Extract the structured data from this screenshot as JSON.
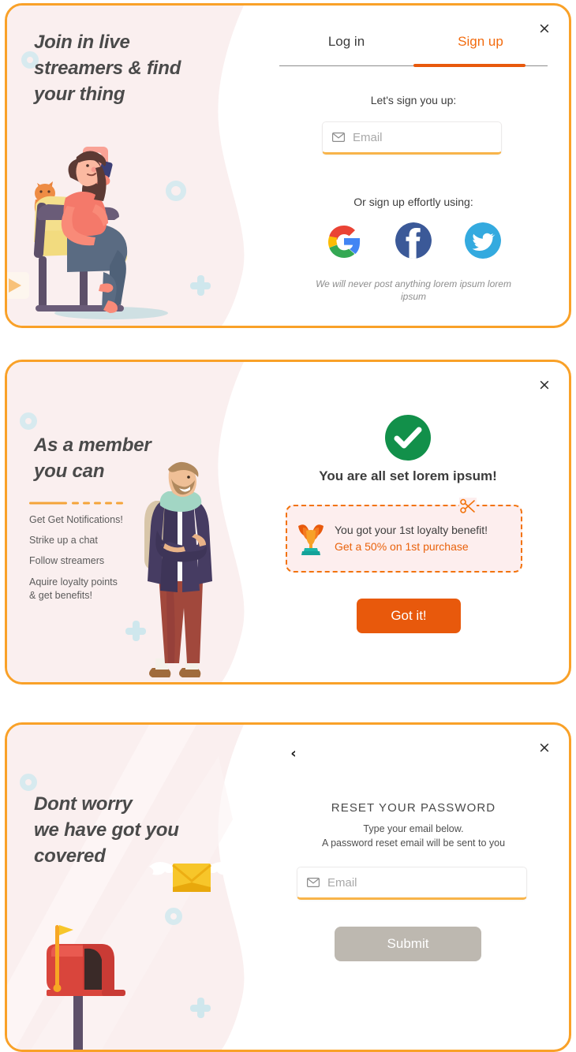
{
  "theme": {
    "card_border": "#F9A128",
    "accent_orange": "#E8590C",
    "accent_orange_light": "#F26B0F",
    "panel_pink": "#FAEFEF",
    "success_green": "#12904A",
    "disabled_grey": "#BDB8B0",
    "input_underline": "#F8B44A",
    "decor_blue": "#CFE7ED"
  },
  "cards": [
    {
      "id": "signup",
      "close_label": "×",
      "close_icon": "close-icon",
      "headline": [
        "Join in live",
        "streamers & find",
        "your thing"
      ],
      "illustration": "woman-on-chair-with-cat-illustration",
      "tabs": [
        {
          "label": "Log in",
          "active": false
        },
        {
          "label": "Sign up",
          "active": true
        }
      ],
      "prompt": "Let's sign you up:",
      "email": {
        "placeholder": "Email",
        "value": "",
        "icon": "envelope-icon"
      },
      "social_prompt": "Or sign up effortly using:",
      "social": [
        {
          "name": "google-icon",
          "label": "Google",
          "color": "#EA4335"
        },
        {
          "name": "facebook-icon",
          "label": "Facebook",
          "color": "#3B5998"
        },
        {
          "name": "twitter-icon",
          "label": "Twitter",
          "color": "#34AADF"
        }
      ],
      "disclaimer": "We will never post anything lorem ipsum lorem ipsum"
    },
    {
      "id": "success",
      "close_label": "×",
      "close_icon": "close-icon",
      "headline": [
        "As a member",
        "you can"
      ],
      "illustration": "standing-man-with-backpack-illustration",
      "benefits": [
        "Get Get Notifications!",
        "Strike up a chat",
        "Follow streamers",
        "Aquire loyalty points\n& get benefits!"
      ],
      "status_icon": "check-circle-icon",
      "title": "You are all set lorem ipsum!",
      "coupon": {
        "icon": "trophy-icon",
        "cut_icon": "scissors-icon",
        "line1": "You got your 1st loyalty benefit!",
        "line2": "Get a 50% on 1st purchase"
      },
      "cta_label": "Got it!"
    },
    {
      "id": "reset",
      "close_label": "×",
      "close_icon": "close-icon",
      "back_label": "‹",
      "back_icon": "chevron-left-icon",
      "headline": [
        "Dont worry",
        "we have got you",
        "covered"
      ],
      "illustration": "mailbox-with-flying-envelope-illustration",
      "title": "RESET YOUR PASSWORD",
      "subtitle": [
        "Type your email below.",
        "A password reset email will be sent to you"
      ],
      "email": {
        "placeholder": "Email",
        "value": "",
        "icon": "envelope-icon"
      },
      "submit_label": "Submit",
      "submit_disabled": true
    }
  ]
}
